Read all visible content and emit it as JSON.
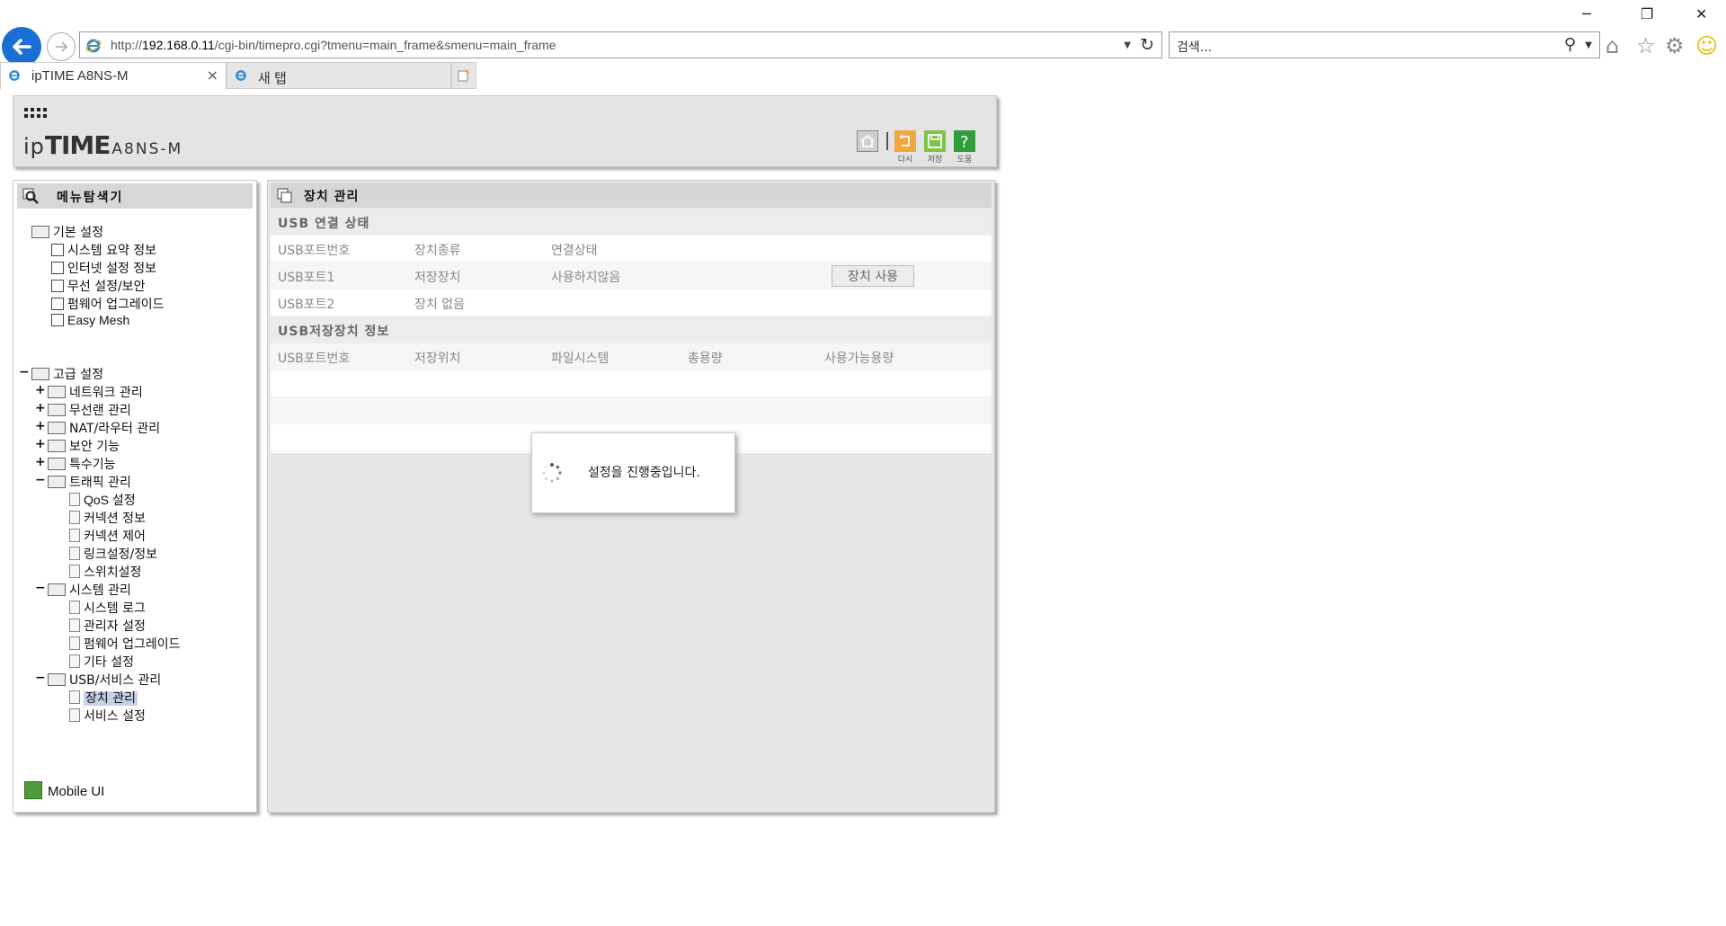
{
  "browser": {
    "url_prefix": "http://",
    "url_host": "192.168.0.11",
    "url_path": "/cgi-bin/timepro.cgi?tmenu=main_frame&smenu=main_frame",
    "search_placeholder": "검색...",
    "tabs": [
      {
        "label": "ipTIME A8NS-M",
        "close": "×"
      },
      {
        "label": "새 탭"
      }
    ],
    "window_controls": {
      "minimize": "─",
      "restore": "❐",
      "close": "✕"
    }
  },
  "header": {
    "logo_a": "ip",
    "logo_b": "TIME",
    "logo_model": "A8NS-M",
    "buttons": [
      {
        "name": "home",
        "label": ""
      },
      {
        "name": "back",
        "label": "다시"
      },
      {
        "name": "save",
        "label": "저장"
      },
      {
        "name": "help",
        "label": "도움"
      }
    ]
  },
  "left_menu": {
    "title": "메뉴탐색기",
    "basic": {
      "label": "기본 설정",
      "items": [
        "시스템 요약 정보",
        "인터넷 설정 정보",
        "무선 설정/보안",
        "펌웨어 업그레이드",
        "Easy Mesh"
      ]
    },
    "advanced": {
      "label": "고급 설정",
      "groups": [
        {
          "label": "네트워크 관리",
          "expanded": false
        },
        {
          "label": "무선랜 관리",
          "expanded": false
        },
        {
          "label": "NAT/라우터 관리",
          "expanded": false
        },
        {
          "label": "보안 기능",
          "expanded": false
        },
        {
          "label": "특수기능",
          "expanded": false
        },
        {
          "label": "트래픽 관리",
          "expanded": true,
          "children": [
            "QoS 설정",
            "커넥션 정보",
            "커넥션 제어",
            "링크설정/정보",
            "스위치설정"
          ]
        },
        {
          "label": "시스템 관리",
          "expanded": true,
          "children": [
            "시스템 로그",
            "관리자 설정",
            "펌웨어 업그레이드",
            "기타 설정"
          ]
        },
        {
          "label": "USB/서비스 관리",
          "expanded": true,
          "children": [
            "장치 관리",
            "서비스 설정"
          ]
        }
      ],
      "selected": "장치 관리"
    },
    "mobile_ui": "Mobile UI",
    "plus": "+",
    "minus": "−"
  },
  "main": {
    "title": "장치 관리",
    "usb_status": {
      "section": "USB 연결 상태",
      "headers": [
        "USB포트번호",
        "장치종류",
        "연결상태"
      ],
      "rows": [
        {
          "port": "USB포트1",
          "type": "저장장치",
          "status": "사용하지않음",
          "button": "장치 사용"
        },
        {
          "port": "USB포트2",
          "type": "장치 없음",
          "status": ""
        }
      ]
    },
    "storage_info": {
      "section": "USB저장장치 정보",
      "headers": [
        "USB포트번호",
        "저장위치",
        "파일시스템",
        "총용량",
        "사용가능용량"
      ]
    }
  },
  "modal": {
    "message": "설정을 진행중입니다."
  },
  "colors": {
    "accent_blue": "#1a6fd6",
    "selected_bg": "#c4d1ea",
    "panel_bg": "#e7e7e7"
  }
}
